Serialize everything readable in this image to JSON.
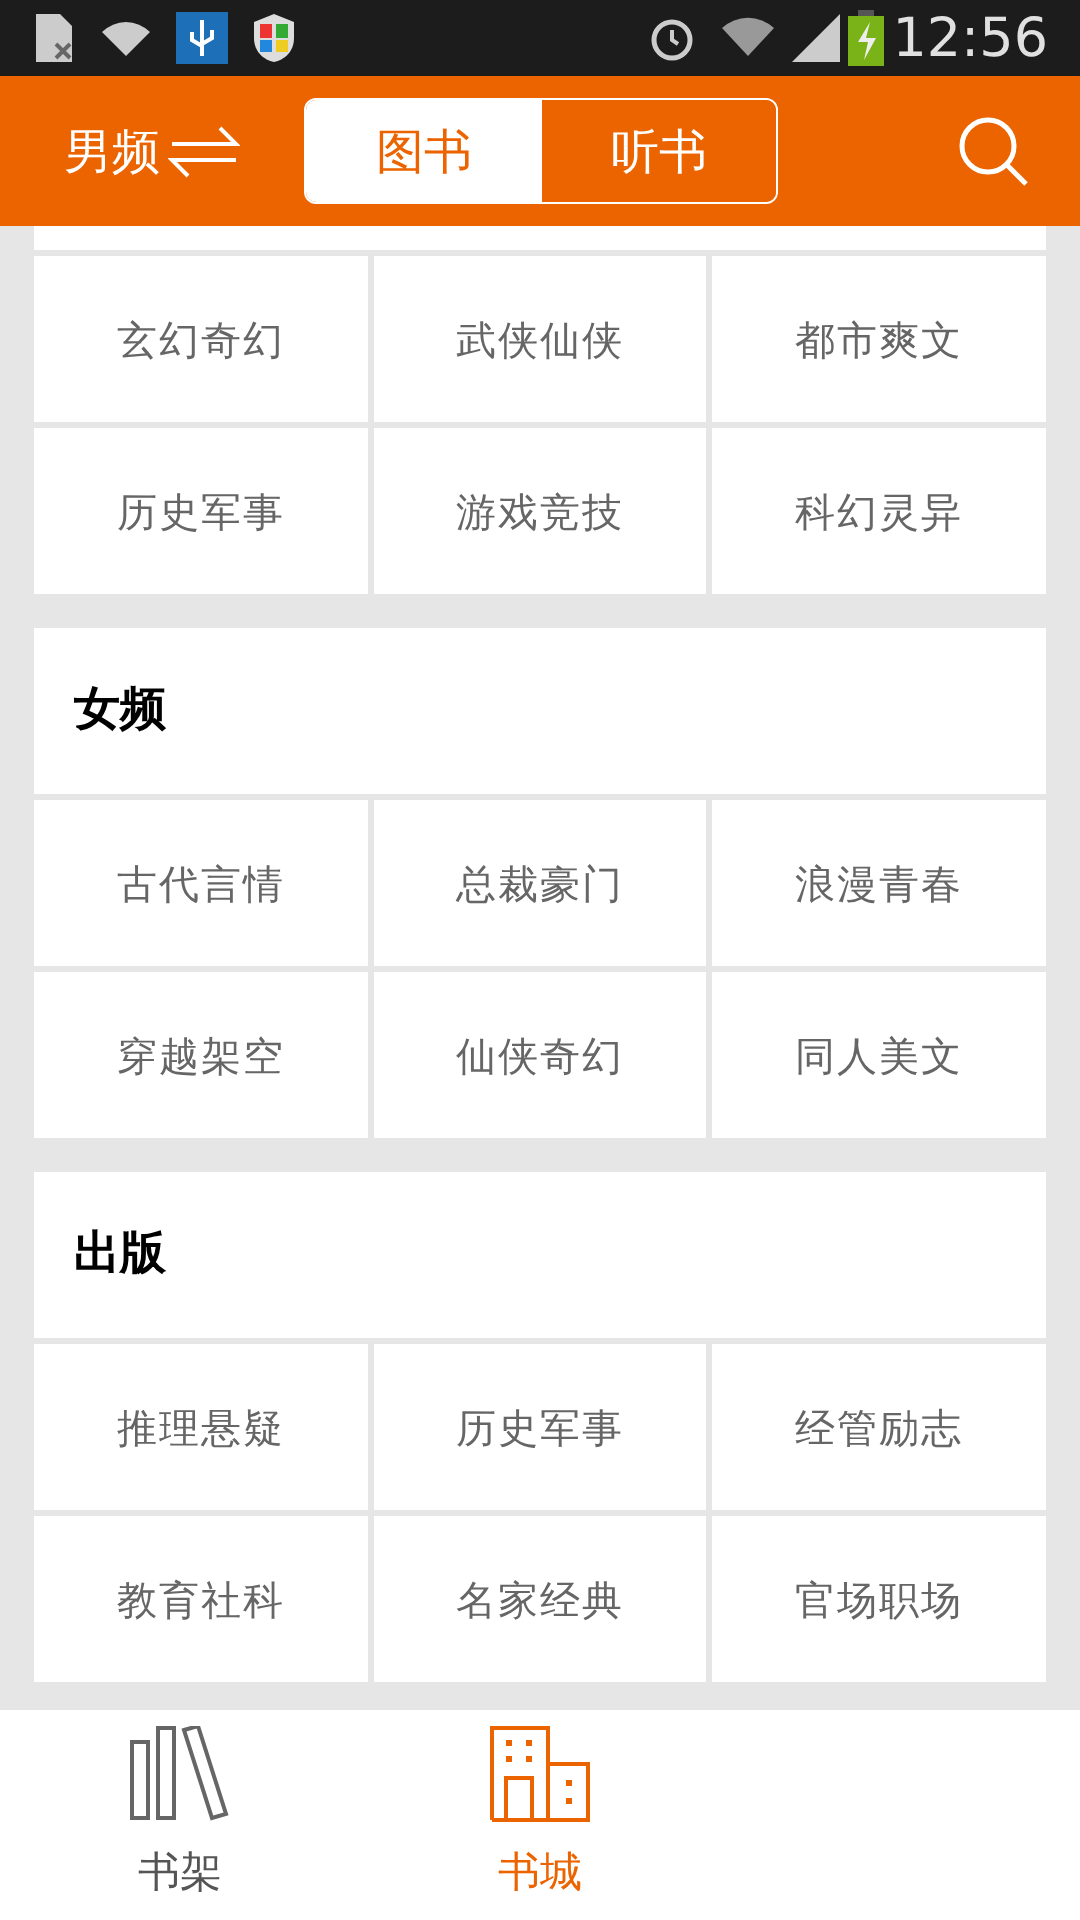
{
  "status_bar": {
    "time": "12:56"
  },
  "header": {
    "channel": "男频",
    "tabs": [
      {
        "label": "图书",
        "selected": true
      },
      {
        "label": "听书",
        "selected": false
      }
    ]
  },
  "sections": [
    {
      "items": [
        "玄幻奇幻",
        "武侠仙侠",
        "都市爽文",
        "历史军事",
        "游戏竞技",
        "科幻灵异"
      ]
    },
    {
      "title": "女频",
      "items": [
        "古代言情",
        "总裁豪门",
        "浪漫青春",
        "穿越架空",
        "仙侠奇幻",
        "同人美文"
      ]
    },
    {
      "title": "出版",
      "items": [
        "推理悬疑",
        "历史军事",
        "经管励志",
        "教育社科",
        "名家经典",
        "官场职场"
      ]
    }
  ],
  "bottom_nav": [
    {
      "label": "书架",
      "kind": "shelf",
      "selected": false
    },
    {
      "label": "书城",
      "kind": "store",
      "selected": true
    }
  ]
}
